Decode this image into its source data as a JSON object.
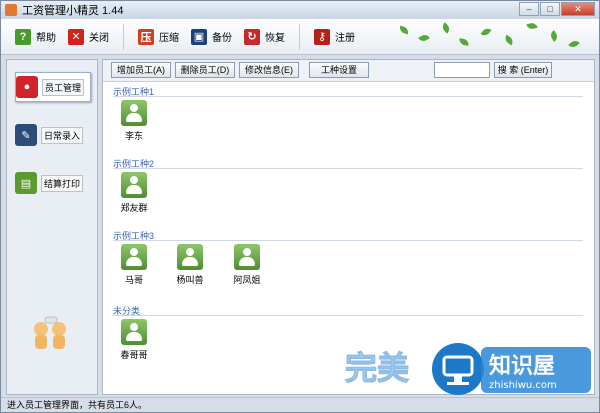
{
  "window": {
    "title": "工资管理小精灵 1.44"
  },
  "toolbar": {
    "items": [
      {
        "label": "帮助",
        "icon": "help-icon",
        "color": "#4a9a2c"
      },
      {
        "label": "关闭",
        "icon": "close-icon",
        "color": "#d2221b"
      },
      {
        "label": "压缩",
        "icon": "compress-icon",
        "color": "#d0401c"
      },
      {
        "label": "备份",
        "icon": "save-icon",
        "color": "#1e3f7a"
      },
      {
        "label": "恢复",
        "icon": "restore-icon",
        "color": "#c62a2a"
      },
      {
        "label": "注册",
        "icon": "key-icon",
        "color": "#b32418"
      }
    ]
  },
  "sidebar": {
    "items": [
      {
        "label": "员工管理",
        "icon": "employee-icon",
        "color": "#d3232a",
        "selected": true
      },
      {
        "label": "日常录入",
        "icon": "pen-icon",
        "color": "#2b4d7a",
        "selected": false
      },
      {
        "label": "结算打印",
        "icon": "printer-icon",
        "color": "#5a9a2f",
        "selected": false
      }
    ]
  },
  "buttons": {
    "add": "增加员工(A)",
    "delete": "删除员工(D)",
    "edit": "修改信息(E)",
    "types": "工种设置",
    "search": "搜 索 (Enter)"
  },
  "search": {
    "value": ""
  },
  "groups": [
    {
      "label": "示例工种1",
      "employees": [
        "李东"
      ]
    },
    {
      "label": "示例工种2",
      "employees": [
        "郑友群"
      ]
    },
    {
      "label": "示例工种3",
      "employees": [
        "马哥",
        "杨叫兽",
        "阿凤姐"
      ]
    },
    {
      "label": "未分类",
      "employees": [
        "春哥哥"
      ]
    }
  ],
  "status": {
    "text": "进入员工管理界面，共有员工6人。"
  },
  "watermark": {
    "text1": "完美",
    "text2": "知识屋",
    "text3": "zhishiwu.com"
  }
}
